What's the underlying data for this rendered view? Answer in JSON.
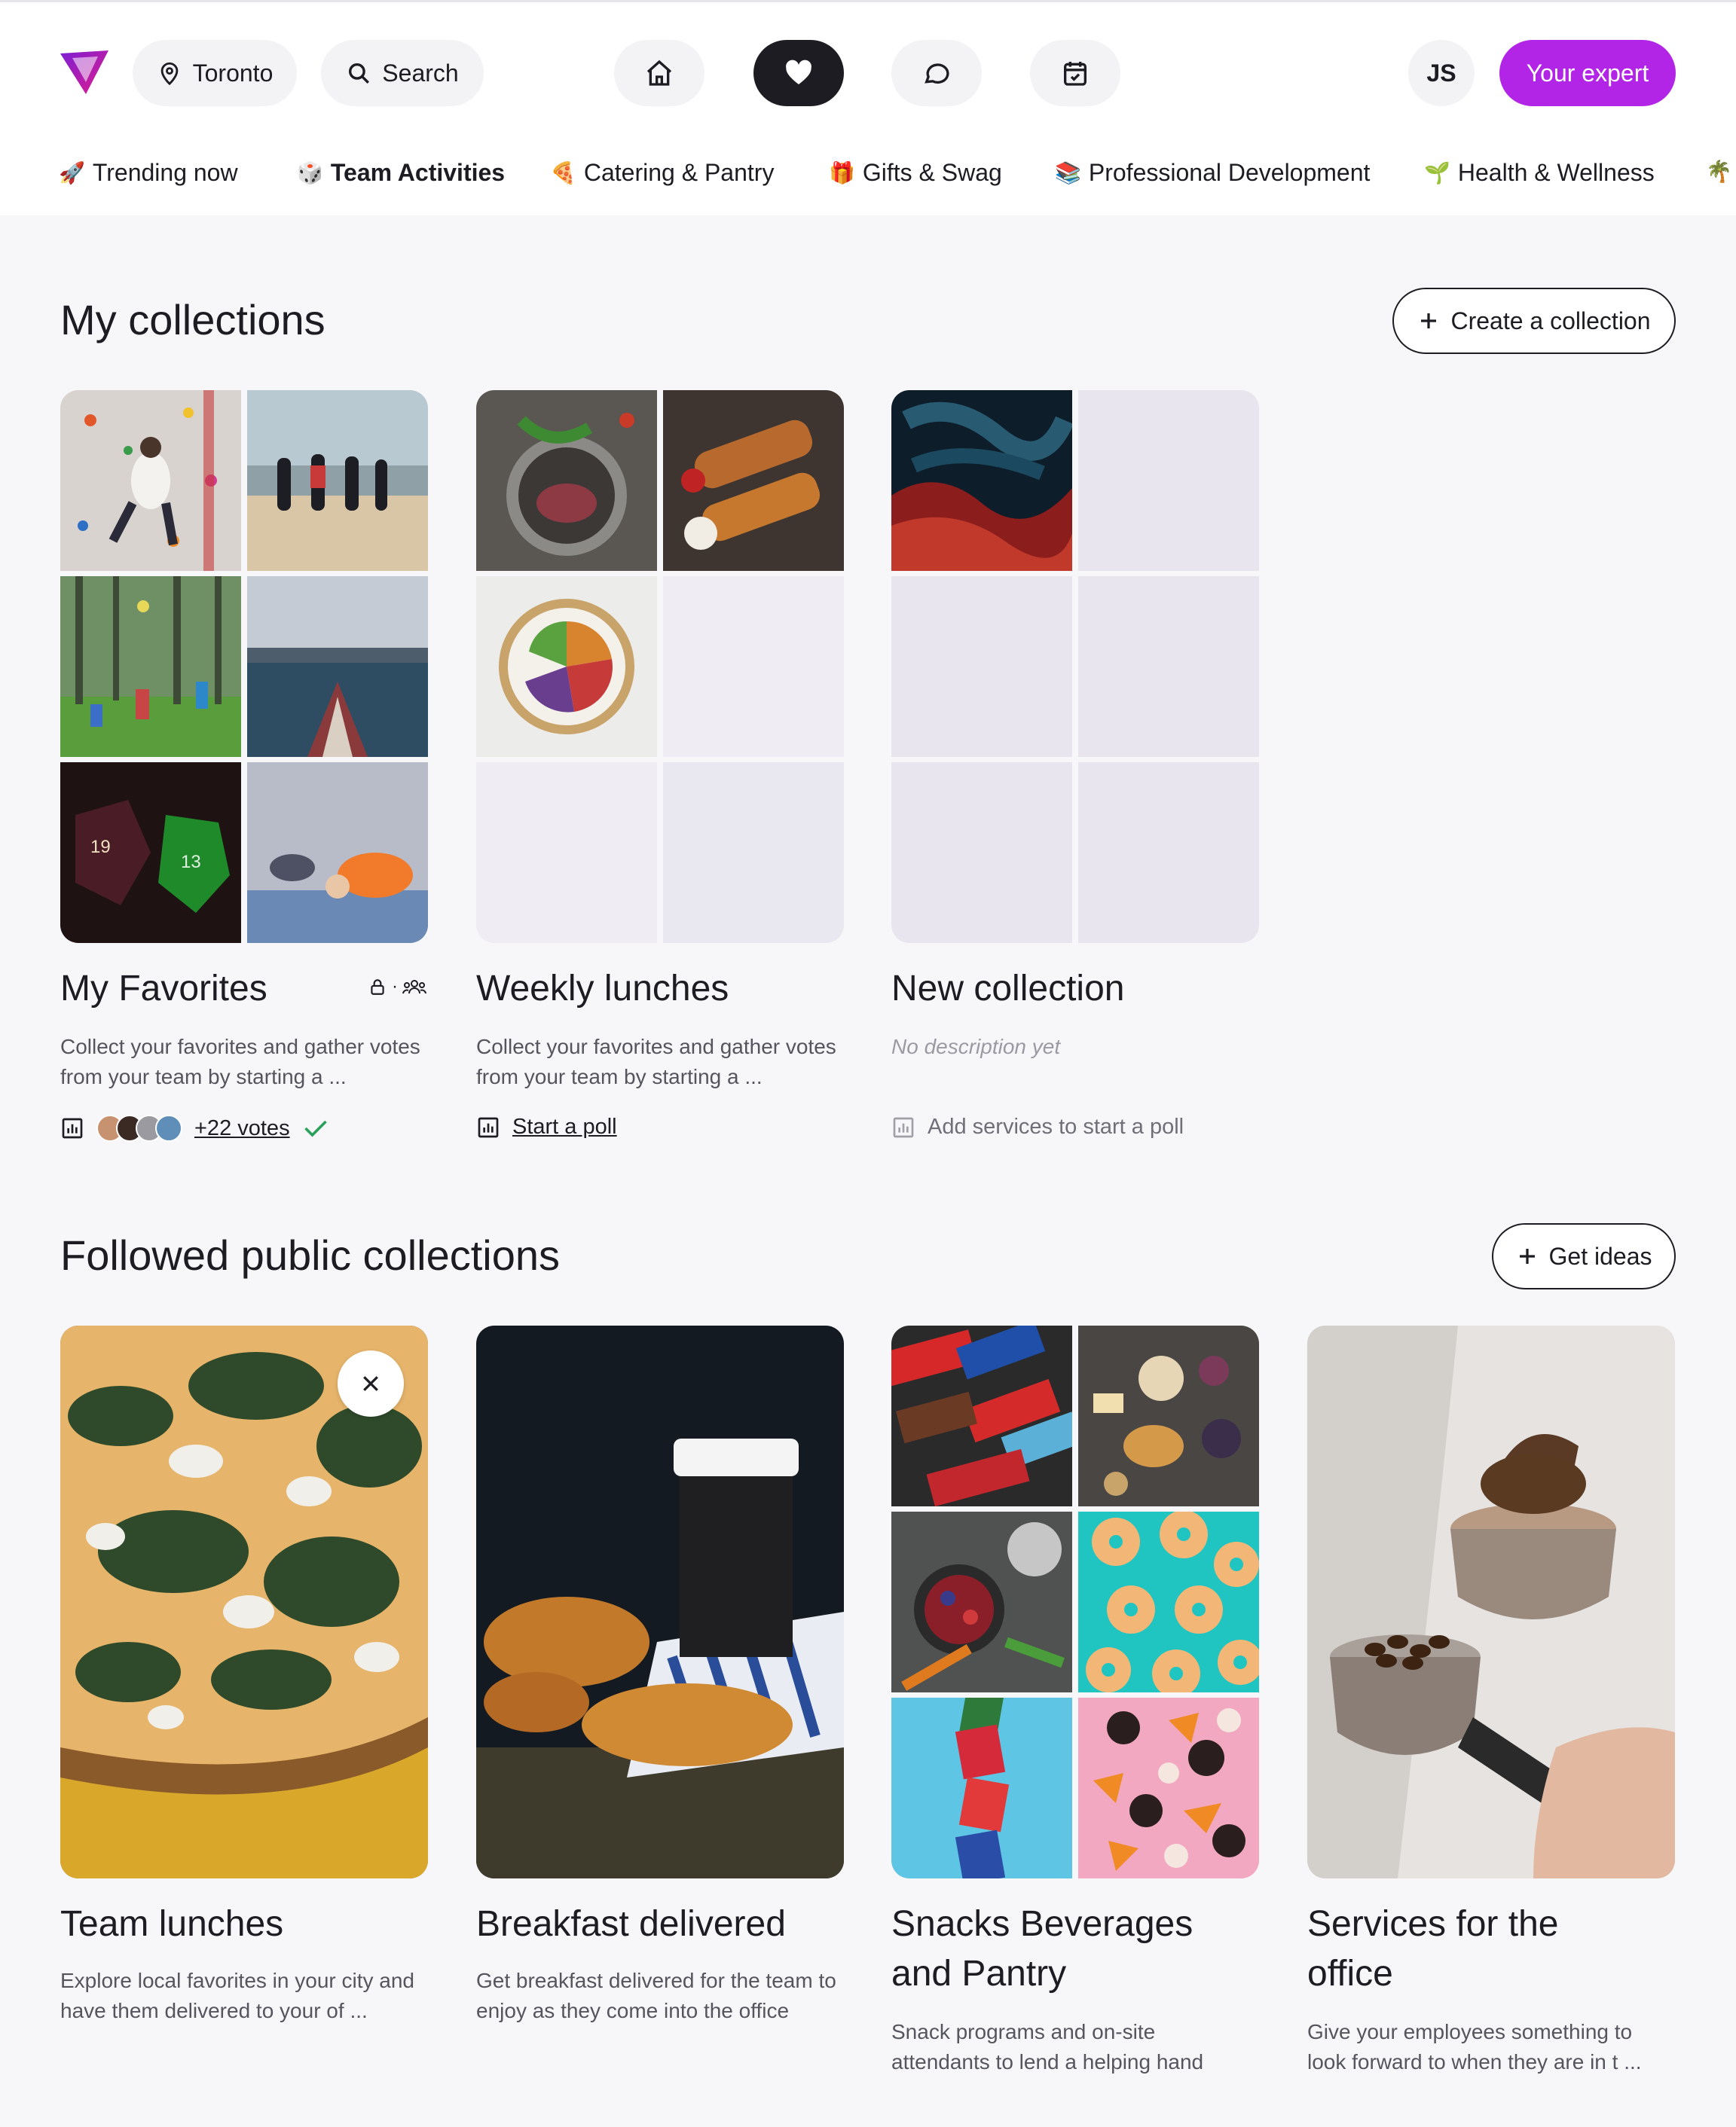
{
  "header": {
    "location_label": "Toronto",
    "search_label": "Search",
    "avatar_initials": "JS",
    "expert_button": "Your expert"
  },
  "categories": [
    {
      "emoji": "🚀",
      "label": "Trending now"
    },
    {
      "emoji": "🎲",
      "label": "Team Activities"
    },
    {
      "emoji": "🍕",
      "label": "Catering & Pantry"
    },
    {
      "emoji": "🎁",
      "label": "Gifts & Swag"
    },
    {
      "emoji": "📚",
      "label": "Professional Development"
    },
    {
      "emoji": "🌱",
      "label": "Health & Wellness"
    },
    {
      "emoji": "🌴",
      "label": ""
    }
  ],
  "my_collections": {
    "title": "My collections",
    "create_button": "Create a collection",
    "cards": [
      {
        "title": "My Favorites",
        "description": "Collect your favorites and gather votes from your team by starting a ...",
        "votes_label": "+22 votes"
      },
      {
        "title": "Weekly lunches",
        "description": "Collect your favorites and gather votes from your team by starting a ...",
        "poll_label": "Start a poll"
      },
      {
        "title": "New collection",
        "description": "No description yet",
        "poll_label": "Add services to start a poll"
      }
    ]
  },
  "followed": {
    "title": "Followed public collections",
    "ideas_button": "Get ideas",
    "cards": [
      {
        "title": "Team lunches",
        "description": "Explore local favorites in your city and have them delivered to your of ..."
      },
      {
        "title": "Breakfast delivered",
        "description": "Get breakfast delivered for the team to enjoy as they come into the office"
      },
      {
        "title_line1": "Snacks Beverages",
        "title_line2": "and Pantry",
        "description": "Snack programs and on-site attendants to lend a helping hand"
      },
      {
        "title_line1": "Services for the",
        "title_line2": "office",
        "description": "Give your employees something to look forward to when they are in t ..."
      }
    ]
  },
  "colors": {
    "accent": "#b224e6",
    "dark": "#1c1c22",
    "background": "#f7f7fa"
  }
}
